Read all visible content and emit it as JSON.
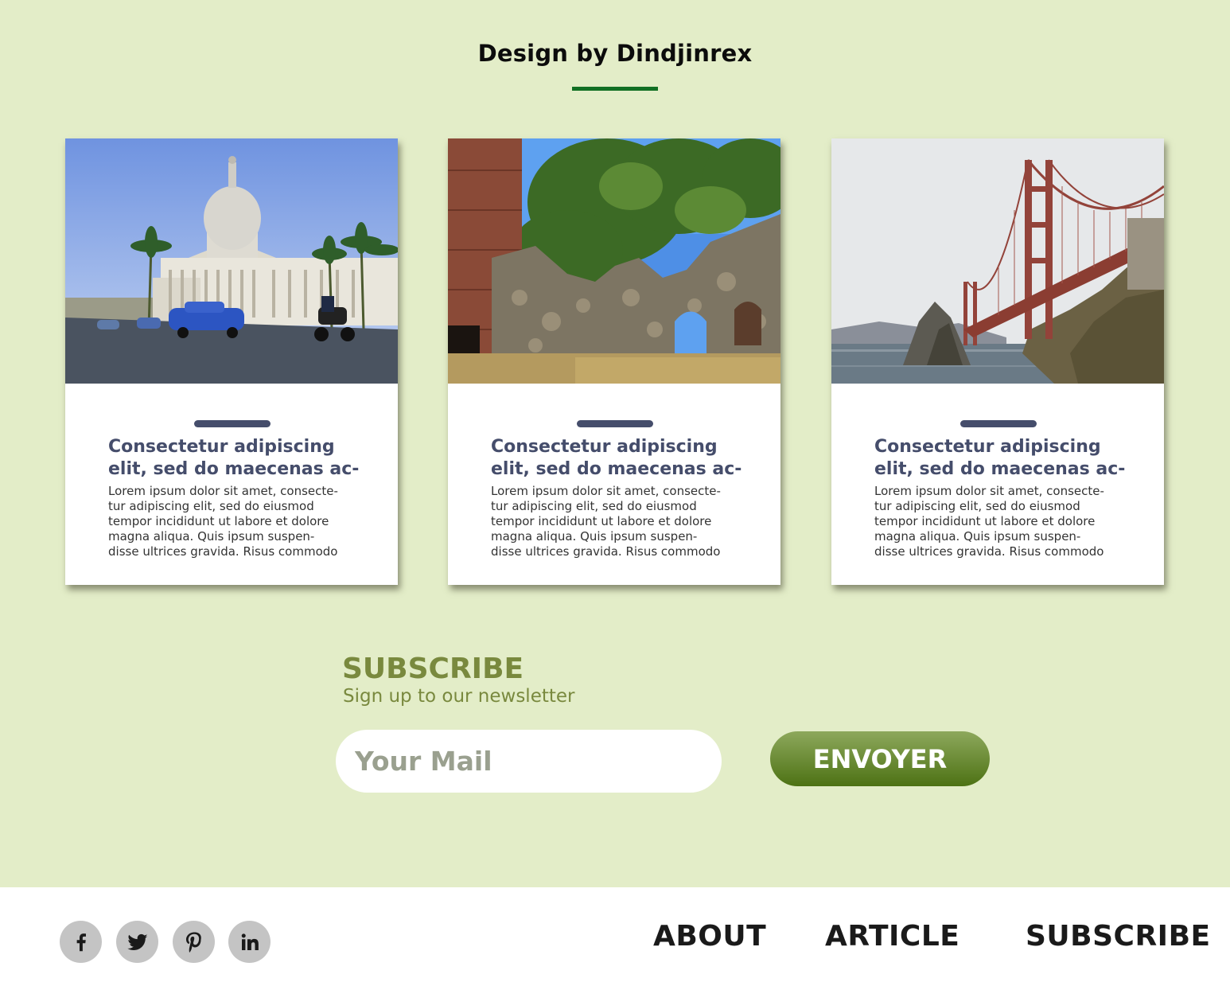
{
  "header": {
    "title": "Design by Dindjinrex"
  },
  "cards": [
    {
      "image": "havana-capitol-photo",
      "title": "Consectetur adipiscing\nelit, sed do maecenas ac-",
      "text": "Lorem ipsum dolor sit amet, consecte-\ntur adipiscing elit, sed do eiusmod\ntempor incididunt ut labore et dolore\nmagna aliqua. Quis ipsum suspen-\ndisse ultrices gravida. Risus commodo"
    },
    {
      "image": "stone-ruins-photo",
      "title": "Consectetur adipiscing\nelit, sed do maecenas ac-",
      "text": "Lorem ipsum dolor sit amet, consecte-\ntur adipiscing elit, sed do eiusmod\ntempor incididunt ut labore et dolore\nmagna aliqua. Quis ipsum suspen-\ndisse ultrices gravida. Risus commodo"
    },
    {
      "image": "golden-gate-bridge-photo",
      "title": "Consectetur adipiscing\nelit, sed do maecenas ac-",
      "text": "Lorem ipsum dolor sit amet, consecte-\ntur adipiscing elit, sed do eiusmod\ntempor incididunt ut labore et dolore\nmagna aliqua. Quis ipsum suspen-\ndisse ultrices gravida. Risus commodo"
    }
  ],
  "subscribe": {
    "heading": "SUBSCRIBE",
    "subtext": "Sign up to our newsletter",
    "input_placeholder": "Your Mail",
    "button_label": "ENVOYER"
  },
  "footer": {
    "social": [
      "facebook-icon",
      "twitter-icon",
      "pinterest-icon",
      "linkedin-icon"
    ],
    "nav": [
      "ABOUT",
      "ARTICLE",
      "SUBSCRIBE"
    ]
  },
  "colors": {
    "background": "#e3edc8",
    "accent_green": "#127024",
    "card_title": "#454d6b",
    "subscribe_green": "#79893e"
  }
}
